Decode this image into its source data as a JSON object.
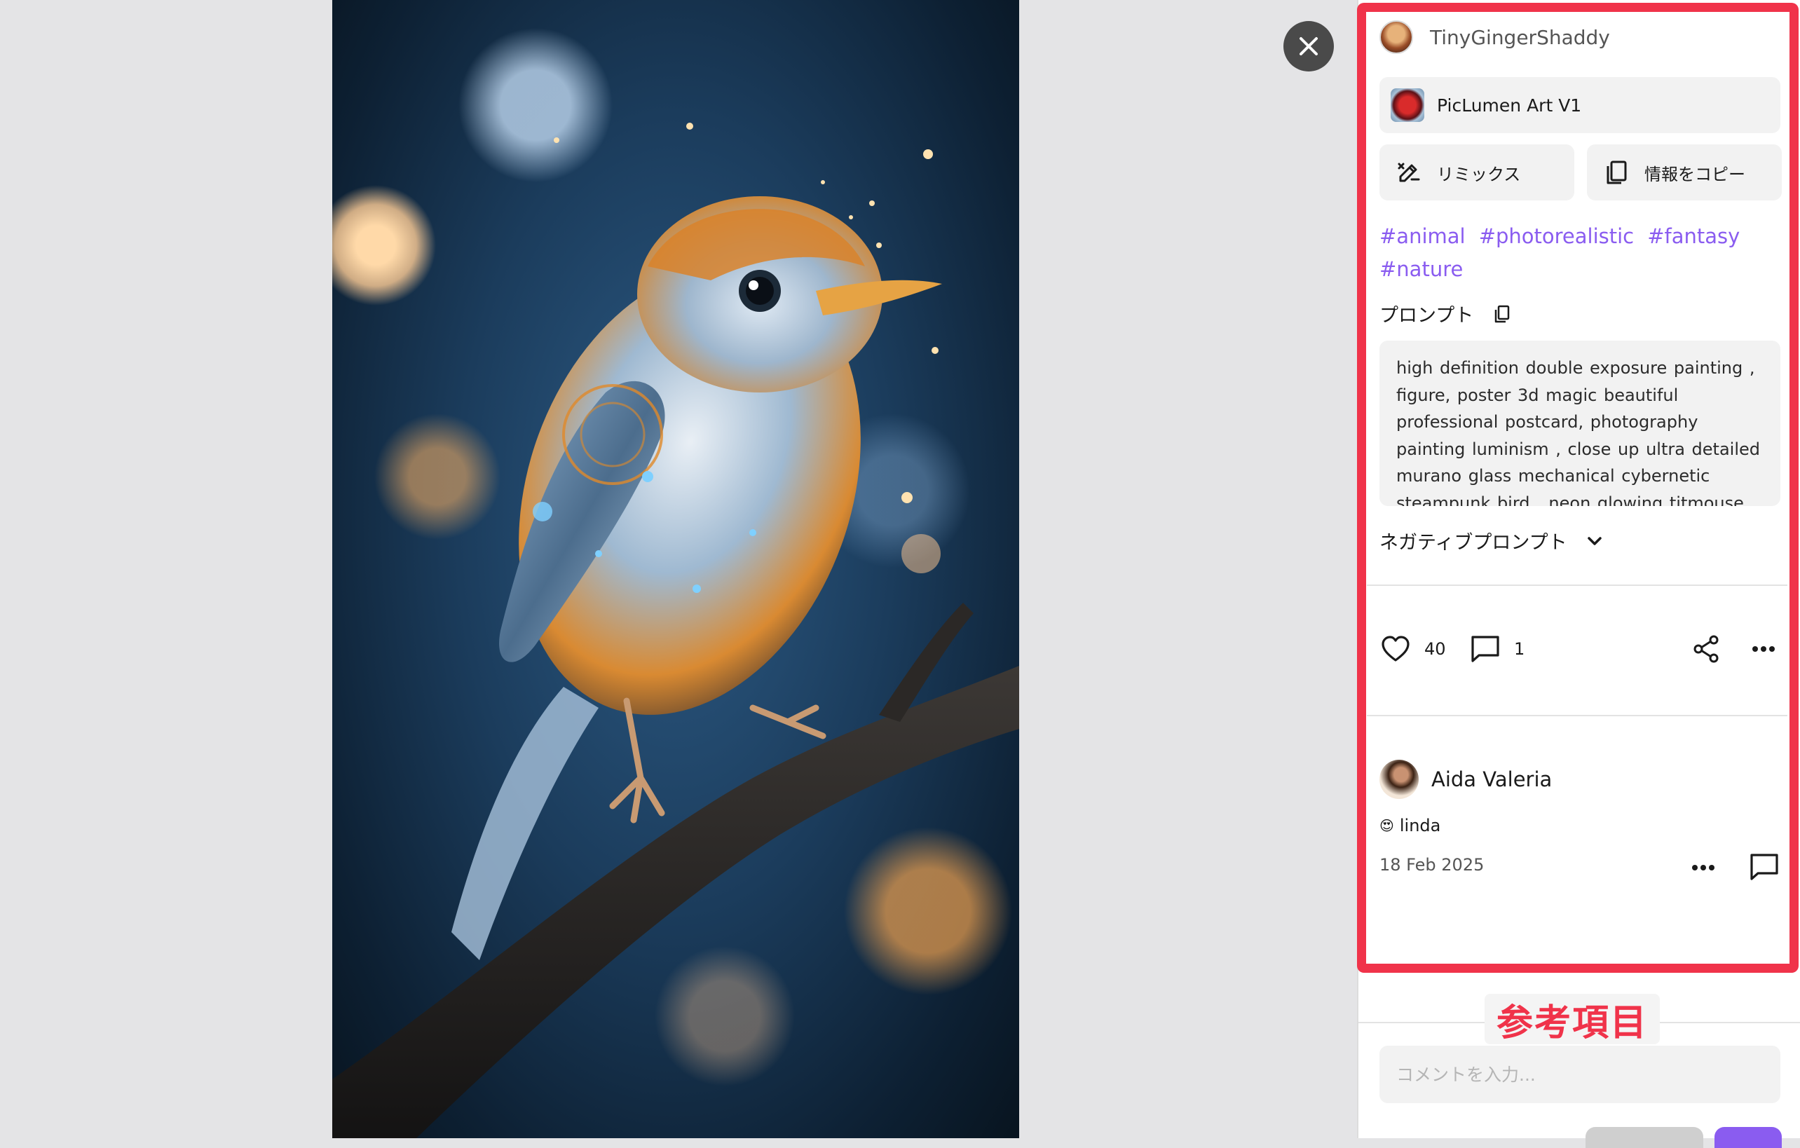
{
  "author": {
    "name": "TinyGingerShaddy",
    "avatar_icon": "user-avatar"
  },
  "model": {
    "name": "PicLumen Art V1",
    "thumb_icon": "rose-thumbnail"
  },
  "actions": {
    "remix_label": "リミックス",
    "copy_info_label": "情報をコピー"
  },
  "tags": [
    "#animal",
    "#photorealistic",
    "#fantasy",
    "#nature"
  ],
  "prompt": {
    "title": "プロンプト",
    "text": "high definition double exposure   painting , figure, poster  3d  magic beautiful professional  postcard,  photography painting  luminism  , close up ultra detailed murano glass  mechanical cybernetic steampunk bird , neon glowing titmouse"
  },
  "negative_prompt": {
    "title": "ネガティブプロンプト",
    "expanded": false
  },
  "stats": {
    "likes": "40",
    "comments": "1"
  },
  "comment": {
    "author": "Aida Valeria",
    "emoji": "😍",
    "text": "linda",
    "date": "18 Feb 2025"
  },
  "annotation_label": "参考項目",
  "comment_input": {
    "placeholder": "コメントを入力..."
  },
  "colors": {
    "accent": "#8a5cf0",
    "highlight": "#f0334a",
    "panel_bg": "#ffffff",
    "chip_bg": "#f2f2f2",
    "page_bg": "#e4e4e6"
  }
}
